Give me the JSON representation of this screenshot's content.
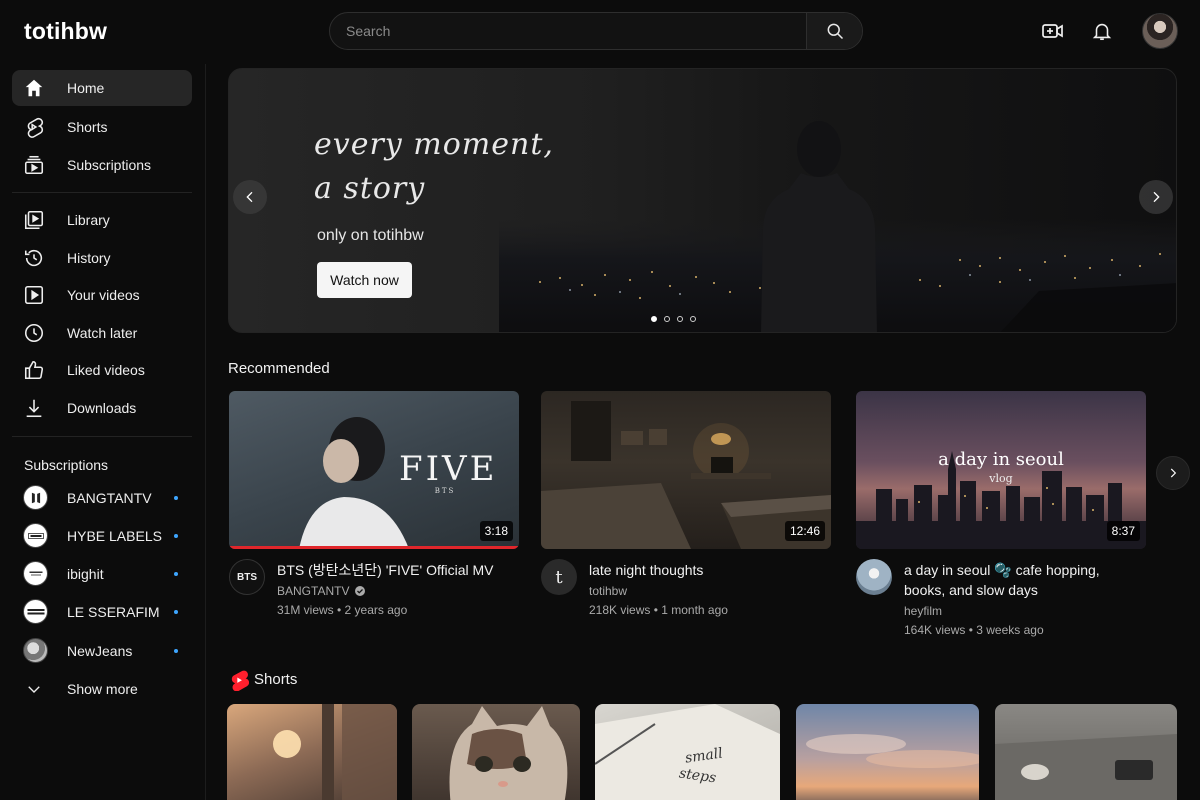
{
  "header": {
    "logo": "totihbw",
    "search_placeholder": "Search",
    "icons": [
      "search-icon",
      "create-icon",
      "bell-icon",
      "avatar"
    ]
  },
  "sidebar": {
    "primary": [
      {
        "label": "Home",
        "icon": "home-icon",
        "active": true
      },
      {
        "label": "Shorts",
        "icon": "shorts-icon"
      },
      {
        "label": "Subscriptions",
        "icon": "subscriptions-icon"
      }
    ],
    "secondary": [
      {
        "label": "Library",
        "icon": "library-icon"
      },
      {
        "label": "History",
        "icon": "history-icon"
      },
      {
        "label": "Your videos",
        "icon": "your-videos-icon"
      },
      {
        "label": "Watch later",
        "icon": "clock-icon"
      },
      {
        "label": "Liked videos",
        "icon": "thumbs-up-icon"
      },
      {
        "label": "Downloads",
        "icon": "download-icon"
      }
    ],
    "subscriptions_heading": "Subscriptions",
    "subscriptions": [
      {
        "label": "BANGTANTV"
      },
      {
        "label": "HYBE LABELS"
      },
      {
        "label": "ibighit"
      },
      {
        "label": "LE SSERAFIM"
      },
      {
        "label": "NewJeans"
      }
    ],
    "show_more": "Show more"
  },
  "hero": {
    "tagline_line1": "every moment,",
    "tagline_line2": "a story",
    "subtitle": "only on totihbw",
    "button": "Watch now",
    "slide_count": 4,
    "active_slide": 1
  },
  "recommended": {
    "heading": "Recommended",
    "videos": [
      {
        "title": "BTS (방탄소년단) 'FIVE' Official MV",
        "channel": "BANGTANTV",
        "verified": true,
        "meta": "31M views • 2 years ago",
        "duration": "3:18",
        "thumb_text": "FIVE",
        "thumb_sub": "BTS",
        "avatar_text": "BTS",
        "watched": true
      },
      {
        "title": "late night thoughts",
        "channel": "totihbw",
        "meta": "218K views • 1 month ago",
        "duration": "12:46",
        "avatar_text": "t"
      },
      {
        "title": "a day in seoul 🫧 cafe hopping, books, and slow days",
        "channel": "heyfilm",
        "meta": "164K views • 3 weeks ago",
        "duration": "8:37",
        "thumb_text": "a day in seoul",
        "thumb_sub": "vlog"
      }
    ]
  },
  "shorts": {
    "heading": "Shorts",
    "items": [
      {
        "thumb": "sunset-window"
      },
      {
        "thumb": "cat"
      },
      {
        "thumb": "notebook",
        "text_line1": "small",
        "text_line2": "steps"
      },
      {
        "thumb": "sky-clouds"
      },
      {
        "thumb": "desk"
      }
    ]
  },
  "colors": {
    "background": "#0c0c0c",
    "accent_red": "#e0262b",
    "new_dot": "#3ea6ff"
  }
}
